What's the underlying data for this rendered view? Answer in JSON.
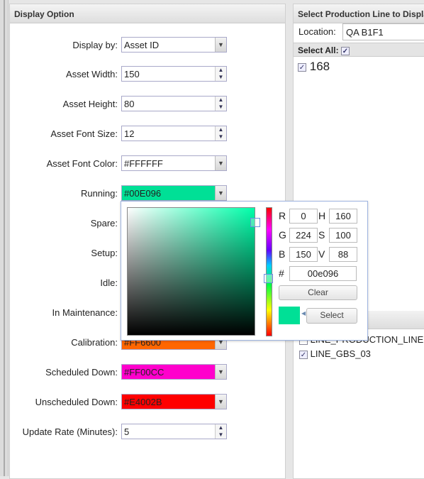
{
  "display_option": {
    "title": "Display Option",
    "rows": [
      {
        "label": "Display by:",
        "value": "Asset ID",
        "type": "select"
      },
      {
        "label": "Asset Width:",
        "value": "150",
        "type": "spin"
      },
      {
        "label": "Asset Height:",
        "value": "80",
        "type": "spin"
      },
      {
        "label": "Asset Font Size:",
        "value": "12",
        "type": "spin"
      },
      {
        "label": "Asset Font Color:",
        "value": "#FFFFFF",
        "type": "color",
        "color": "#FFFFFF"
      },
      {
        "label": "Running:",
        "value": "#00E096",
        "type": "color",
        "color": "#00E096"
      },
      {
        "label": "Spare:",
        "value": "",
        "type": "color",
        "color": "#FFFFFF"
      },
      {
        "label": "Setup:",
        "value": "",
        "type": "color",
        "color": "#FFFFFF"
      },
      {
        "label": "Idle:",
        "value": "",
        "type": "color",
        "color": "#FFFFFF"
      },
      {
        "label": "In Maintenance:",
        "value": "",
        "type": "color",
        "color": "#FFFFFF"
      },
      {
        "label": "Calibration:",
        "value": "#FF6600",
        "type": "color",
        "color": "#FF6600"
      },
      {
        "label": "Scheduled Down:",
        "value": "#FF00CC",
        "type": "color",
        "color": "#FF00CC"
      },
      {
        "label": "Unscheduled Down:",
        "value": "#E4002B",
        "type": "color",
        "color": "#FF0000"
      },
      {
        "label": "Update Rate (Minutes):",
        "value": "5",
        "type": "spin"
      }
    ]
  },
  "production_line": {
    "title": "Select Production Line to Display",
    "location_label": "Location:",
    "location_value": "QA B1F1",
    "select_all_label": "Select All:",
    "lines": [
      {
        "label": "168",
        "checked": true
      }
    ],
    "list2": [
      {
        "label": "LINE_PRODUCTION_LINE",
        "checked": false
      },
      {
        "label": "LINE_GBS_03",
        "checked": true
      }
    ]
  },
  "color_picker": {
    "r_label": "R",
    "g_label": "G",
    "b_label": "B",
    "h_label": "H",
    "s_label": "S",
    "v_label": "V",
    "hash_label": "#",
    "r": "0",
    "g": "224",
    "b": "150",
    "h": "160",
    "s": "100",
    "v": "88",
    "hex": "00e096",
    "clear_label": "Clear",
    "select_label": "Select",
    "preview_color": "#00E096"
  }
}
